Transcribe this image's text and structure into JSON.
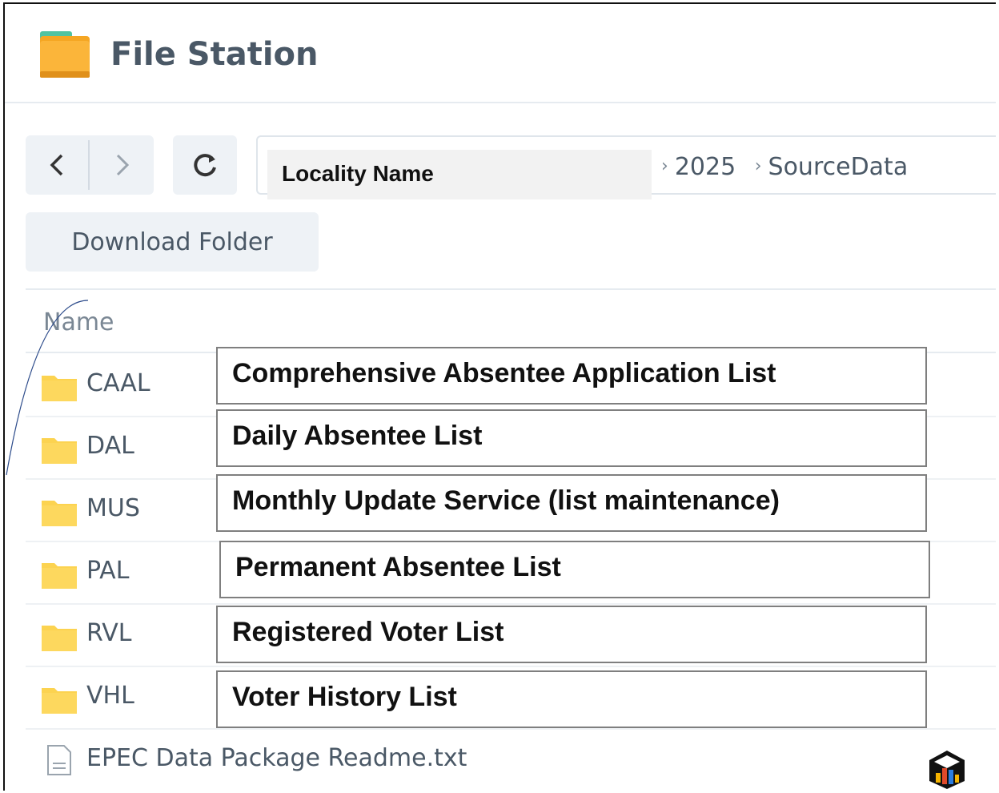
{
  "app": {
    "title": "File Station"
  },
  "nav": {
    "back_icon": "chevron-left-icon",
    "forward_icon": "chevron-right-icon",
    "refresh_icon": "refresh-icon"
  },
  "path": {
    "locality_label": "Locality Name",
    "crumbs": [
      "2025",
      "SourceData"
    ]
  },
  "toolbar": {
    "download_label": "Download Folder"
  },
  "list": {
    "column_name": "Name",
    "folders": [
      {
        "name": "CAAL",
        "description": "Comprehensive Absentee Application List"
      },
      {
        "name": "DAL",
        "description": "Daily Absentee List"
      },
      {
        "name": "MUS",
        "description": "Monthly Update Service (list maintenance)"
      },
      {
        "name": "PAL",
        "description": "Permanent Absentee List"
      },
      {
        "name": "RVL",
        "description": "Registered Voter List"
      },
      {
        "name": "VHL",
        "description": "Voter History List"
      }
    ],
    "file": {
      "name": "EPEC Data Package Readme.txt"
    }
  },
  "colors": {
    "folder": "#fcd350",
    "folder_dark": "#f5b300",
    "text": "#4a5866",
    "button_bg": "#eef2f6"
  }
}
